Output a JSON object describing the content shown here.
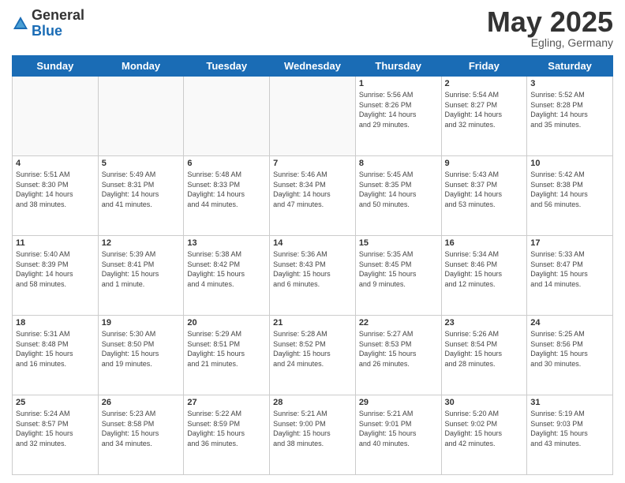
{
  "header": {
    "logo_general": "General",
    "logo_blue": "Blue",
    "month_title": "May 2025",
    "location": "Egling, Germany"
  },
  "weekdays": [
    "Sunday",
    "Monday",
    "Tuesday",
    "Wednesday",
    "Thursday",
    "Friday",
    "Saturday"
  ],
  "weeks": [
    [
      {
        "day": "",
        "info": ""
      },
      {
        "day": "",
        "info": ""
      },
      {
        "day": "",
        "info": ""
      },
      {
        "day": "",
        "info": ""
      },
      {
        "day": "1",
        "info": "Sunrise: 5:56 AM\nSunset: 8:26 PM\nDaylight: 14 hours\nand 29 minutes."
      },
      {
        "day": "2",
        "info": "Sunrise: 5:54 AM\nSunset: 8:27 PM\nDaylight: 14 hours\nand 32 minutes."
      },
      {
        "day": "3",
        "info": "Sunrise: 5:52 AM\nSunset: 8:28 PM\nDaylight: 14 hours\nand 35 minutes."
      }
    ],
    [
      {
        "day": "4",
        "info": "Sunrise: 5:51 AM\nSunset: 8:30 PM\nDaylight: 14 hours\nand 38 minutes."
      },
      {
        "day": "5",
        "info": "Sunrise: 5:49 AM\nSunset: 8:31 PM\nDaylight: 14 hours\nand 41 minutes."
      },
      {
        "day": "6",
        "info": "Sunrise: 5:48 AM\nSunset: 8:33 PM\nDaylight: 14 hours\nand 44 minutes."
      },
      {
        "day": "7",
        "info": "Sunrise: 5:46 AM\nSunset: 8:34 PM\nDaylight: 14 hours\nand 47 minutes."
      },
      {
        "day": "8",
        "info": "Sunrise: 5:45 AM\nSunset: 8:35 PM\nDaylight: 14 hours\nand 50 minutes."
      },
      {
        "day": "9",
        "info": "Sunrise: 5:43 AM\nSunset: 8:37 PM\nDaylight: 14 hours\nand 53 minutes."
      },
      {
        "day": "10",
        "info": "Sunrise: 5:42 AM\nSunset: 8:38 PM\nDaylight: 14 hours\nand 56 minutes."
      }
    ],
    [
      {
        "day": "11",
        "info": "Sunrise: 5:40 AM\nSunset: 8:39 PM\nDaylight: 14 hours\nand 58 minutes."
      },
      {
        "day": "12",
        "info": "Sunrise: 5:39 AM\nSunset: 8:41 PM\nDaylight: 15 hours\nand 1 minute."
      },
      {
        "day": "13",
        "info": "Sunrise: 5:38 AM\nSunset: 8:42 PM\nDaylight: 15 hours\nand 4 minutes."
      },
      {
        "day": "14",
        "info": "Sunrise: 5:36 AM\nSunset: 8:43 PM\nDaylight: 15 hours\nand 6 minutes."
      },
      {
        "day": "15",
        "info": "Sunrise: 5:35 AM\nSunset: 8:45 PM\nDaylight: 15 hours\nand 9 minutes."
      },
      {
        "day": "16",
        "info": "Sunrise: 5:34 AM\nSunset: 8:46 PM\nDaylight: 15 hours\nand 12 minutes."
      },
      {
        "day": "17",
        "info": "Sunrise: 5:33 AM\nSunset: 8:47 PM\nDaylight: 15 hours\nand 14 minutes."
      }
    ],
    [
      {
        "day": "18",
        "info": "Sunrise: 5:31 AM\nSunset: 8:48 PM\nDaylight: 15 hours\nand 16 minutes."
      },
      {
        "day": "19",
        "info": "Sunrise: 5:30 AM\nSunset: 8:50 PM\nDaylight: 15 hours\nand 19 minutes."
      },
      {
        "day": "20",
        "info": "Sunrise: 5:29 AM\nSunset: 8:51 PM\nDaylight: 15 hours\nand 21 minutes."
      },
      {
        "day": "21",
        "info": "Sunrise: 5:28 AM\nSunset: 8:52 PM\nDaylight: 15 hours\nand 24 minutes."
      },
      {
        "day": "22",
        "info": "Sunrise: 5:27 AM\nSunset: 8:53 PM\nDaylight: 15 hours\nand 26 minutes."
      },
      {
        "day": "23",
        "info": "Sunrise: 5:26 AM\nSunset: 8:54 PM\nDaylight: 15 hours\nand 28 minutes."
      },
      {
        "day": "24",
        "info": "Sunrise: 5:25 AM\nSunset: 8:56 PM\nDaylight: 15 hours\nand 30 minutes."
      }
    ],
    [
      {
        "day": "25",
        "info": "Sunrise: 5:24 AM\nSunset: 8:57 PM\nDaylight: 15 hours\nand 32 minutes."
      },
      {
        "day": "26",
        "info": "Sunrise: 5:23 AM\nSunset: 8:58 PM\nDaylight: 15 hours\nand 34 minutes."
      },
      {
        "day": "27",
        "info": "Sunrise: 5:22 AM\nSunset: 8:59 PM\nDaylight: 15 hours\nand 36 minutes."
      },
      {
        "day": "28",
        "info": "Sunrise: 5:21 AM\nSunset: 9:00 PM\nDaylight: 15 hours\nand 38 minutes."
      },
      {
        "day": "29",
        "info": "Sunrise: 5:21 AM\nSunset: 9:01 PM\nDaylight: 15 hours\nand 40 minutes."
      },
      {
        "day": "30",
        "info": "Sunrise: 5:20 AM\nSunset: 9:02 PM\nDaylight: 15 hours\nand 42 minutes."
      },
      {
        "day": "31",
        "info": "Sunrise: 5:19 AM\nSunset: 9:03 PM\nDaylight: 15 hours\nand 43 minutes."
      }
    ]
  ]
}
